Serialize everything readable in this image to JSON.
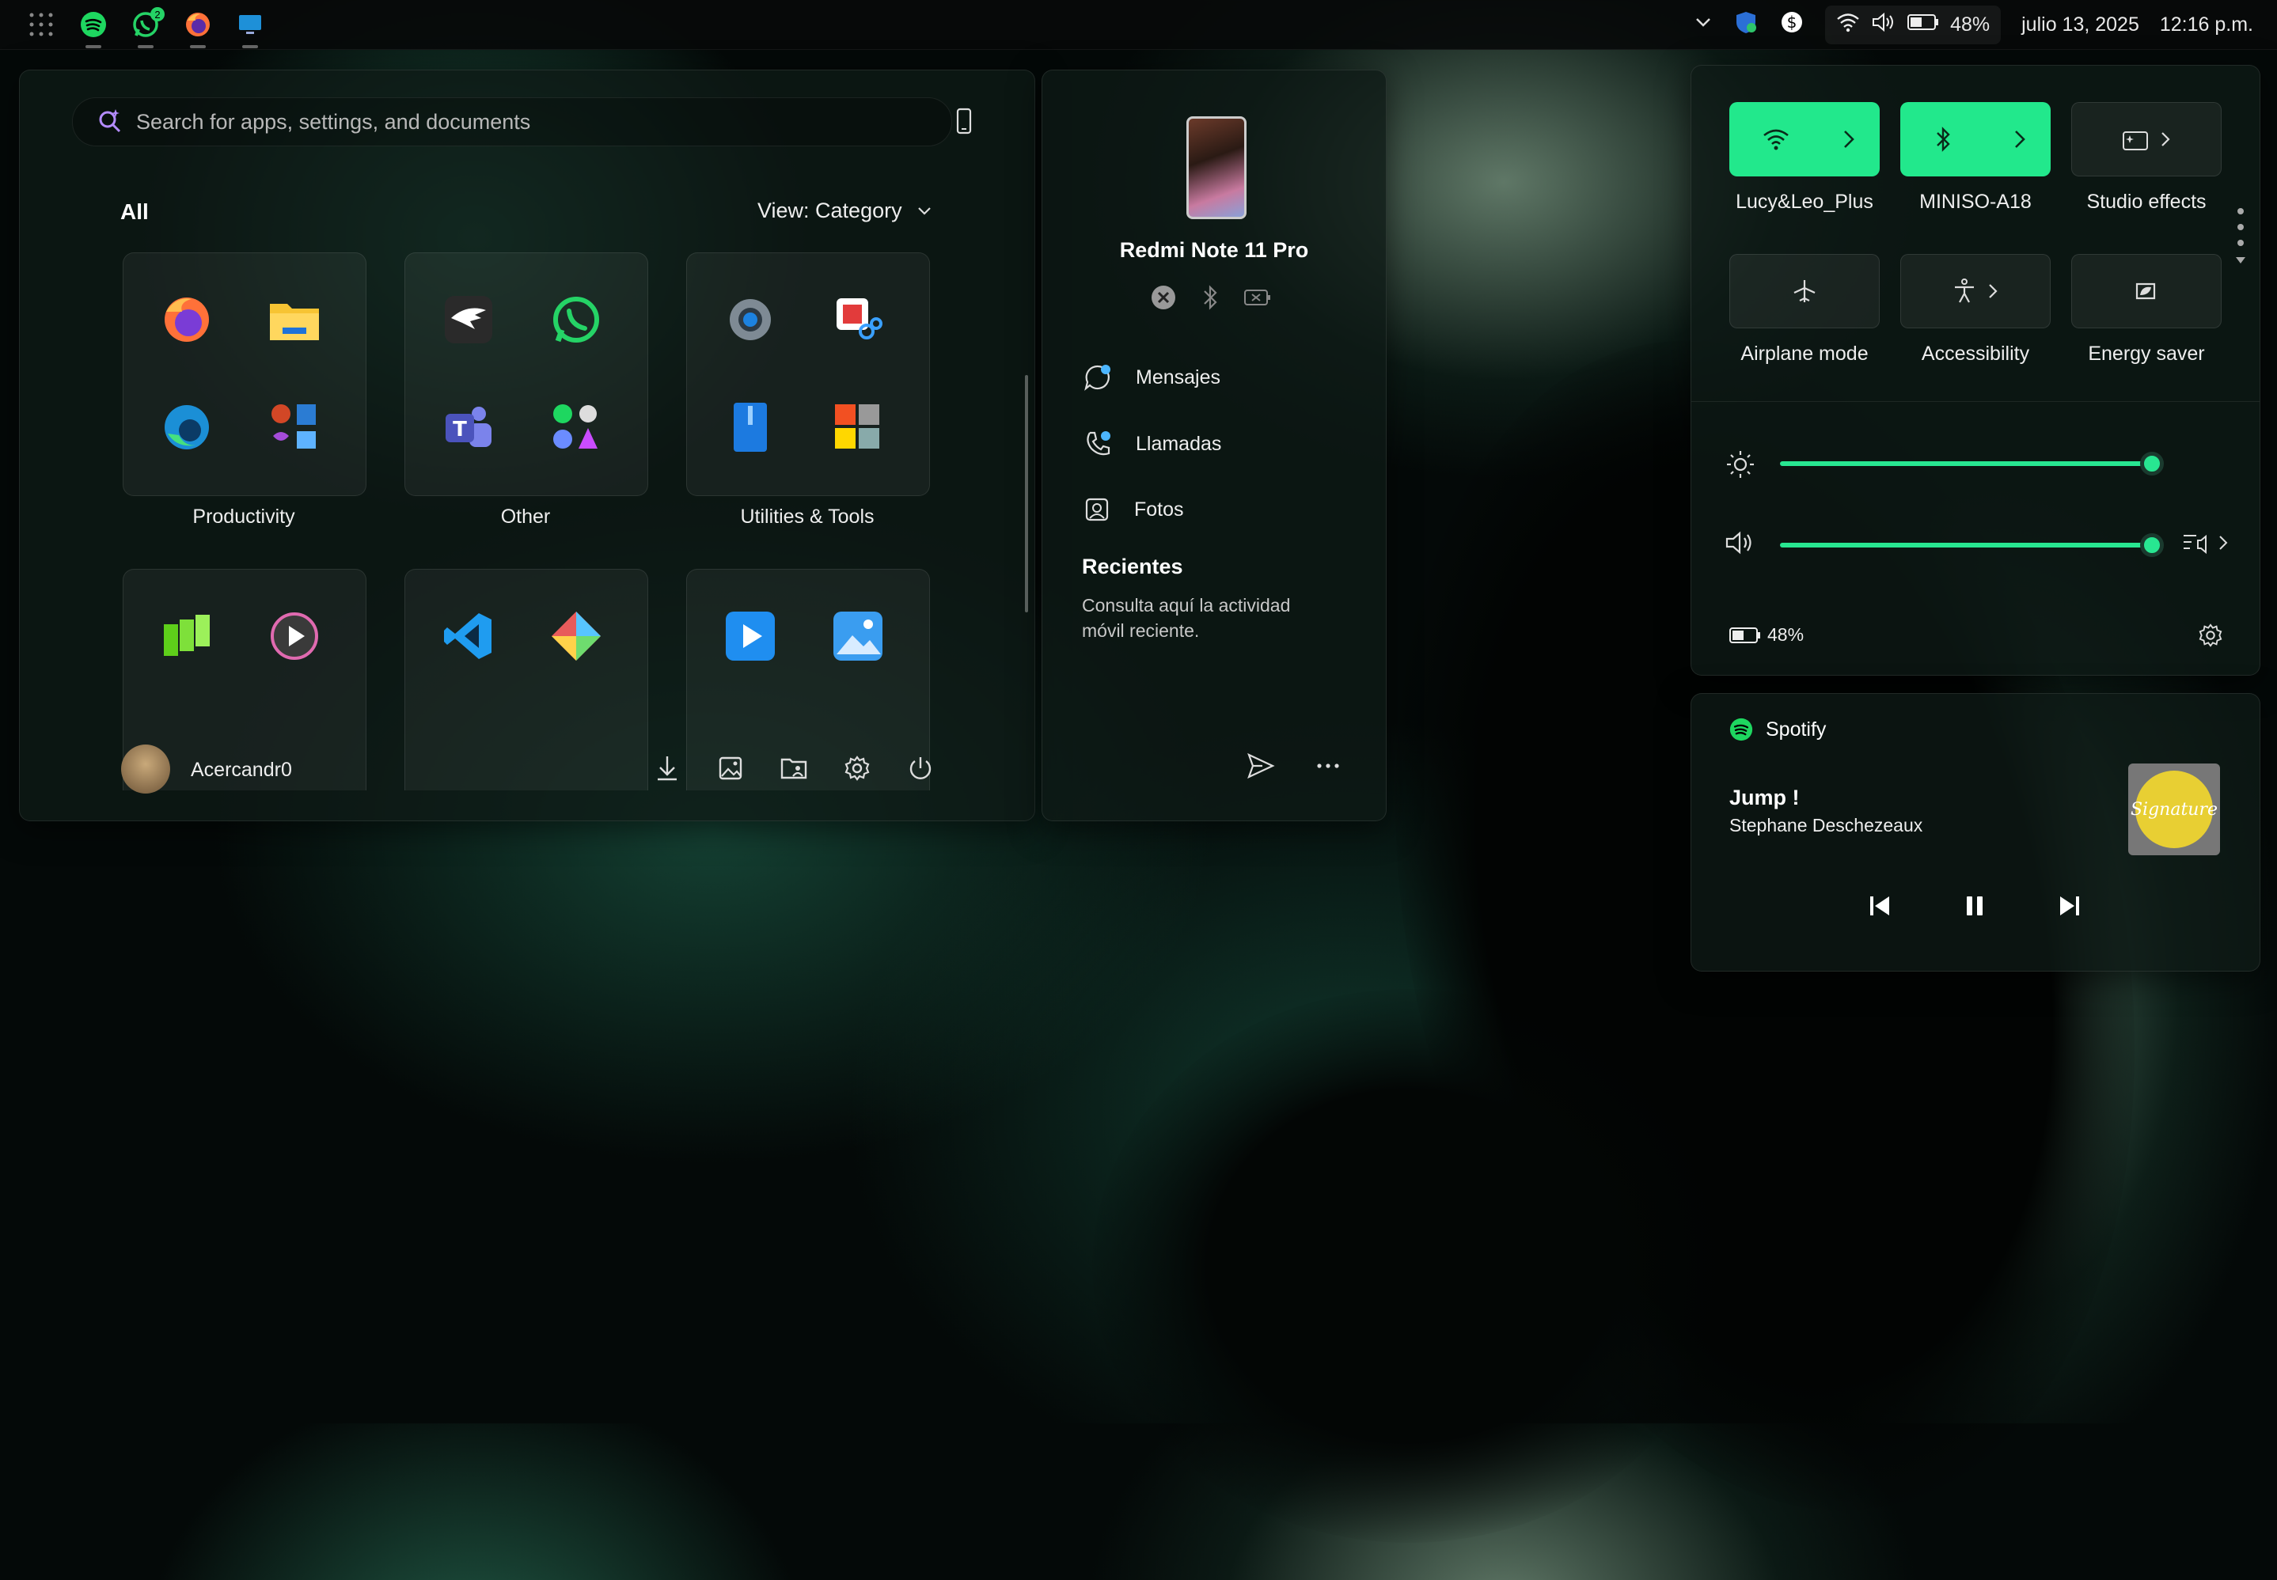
{
  "taskbar": {
    "apps": [
      "grid-icon",
      "spotify-icon",
      "whatsapp-icon",
      "firefox-icon",
      "remote-desktop-icon"
    ],
    "whatsapp_badge": "2",
    "battery": "48%",
    "date": "julio 13, 2025",
    "time": "12:16 p.m."
  },
  "start": {
    "search_placeholder": "Search for apps, settings, and documents",
    "all_label": "All",
    "view_label": "View: Category",
    "folders": [
      {
        "label": "Productivity",
        "apps": [
          "firefox-icon",
          "file-explorer-icon",
          "edge-icon",
          "office-icon"
        ]
      },
      {
        "label": "Other",
        "apps": [
          "eagle-icon",
          "whatsapp-icon",
          "teams-icon",
          "misc-apps-icon"
        ]
      },
      {
        "label": "Utilities & Tools",
        "apps": [
          "settings-icon",
          "snipping-tool-icon",
          "zip-icon",
          "store-calculator-icon"
        ]
      },
      {
        "label": "",
        "apps": [
          "green-app-icon",
          "media-player-icon"
        ]
      },
      {
        "label": "",
        "apps": [
          "vscode-icon",
          "git-tool-icon"
        ]
      },
      {
        "label": "",
        "apps": [
          "video-player-icon",
          "photos-icon"
        ]
      }
    ],
    "user_name": "Acercandr0"
  },
  "phone": {
    "device_name": "Redmi Note 11 Pro",
    "items": [
      "Mensajes",
      "Llamadas",
      "Fotos"
    ],
    "recent_title": "Recientes",
    "recent_text_1": "Consulta aquí la actividad",
    "recent_text_2": "móvil reciente."
  },
  "quick_settings": {
    "tiles": [
      {
        "label": "Lucy&Leo_Plus",
        "icon": "wifi-icon",
        "on": true
      },
      {
        "label": "MINISO-A18",
        "icon": "bluetooth-icon",
        "on": true
      },
      {
        "label": "Studio effects",
        "icon": "studio-effects-icon",
        "on": false
      },
      {
        "label": "Airplane mode",
        "icon": "airplane-icon",
        "on": false
      },
      {
        "label": "Accessibility",
        "icon": "accessibility-icon",
        "on": false
      },
      {
        "label": "Energy saver",
        "icon": "energy-saver-icon",
        "on": false
      }
    ],
    "brightness": 1.0,
    "volume": 1.0,
    "battery": "48%",
    "accent": "#22e88c"
  },
  "media": {
    "app": "Spotify",
    "title": "Jump !",
    "artist": "Stephane Deschezeaux",
    "album_text": "Signature"
  }
}
